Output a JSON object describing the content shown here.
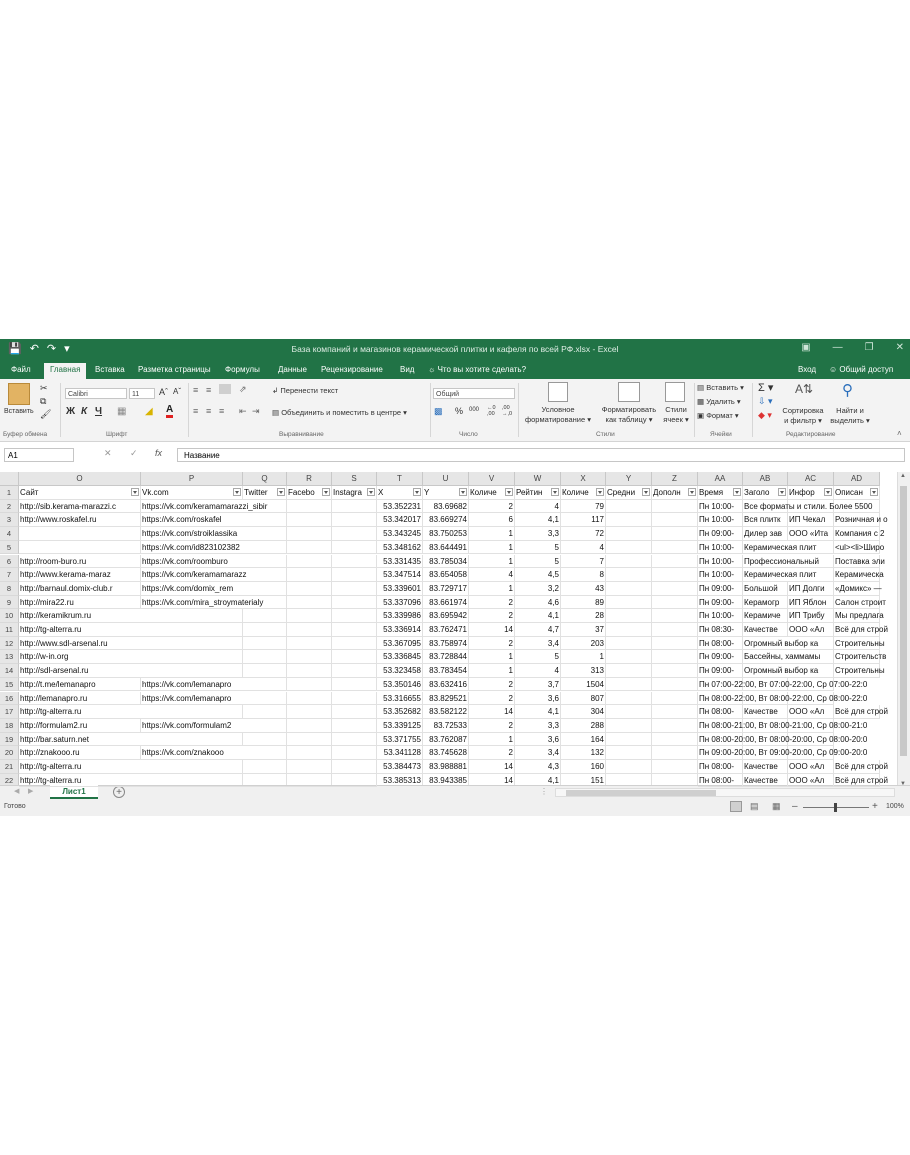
{
  "window": {
    "title": "База компаний и магазинов керамической плитки и кафеля по всей РФ.xlsx - Excel"
  },
  "menu": {
    "tabs": [
      "Файл",
      "Главная",
      "Вставка",
      "Разметка страницы",
      "Формулы",
      "Данные",
      "Рецензирование",
      "Вид"
    ],
    "tell_me": "Что вы хотите сделать?",
    "signin": "Вход",
    "share": "Общий доступ"
  },
  "ribbon": {
    "clipboard": {
      "paste": "Вставить",
      "label": "Буфер обмена"
    },
    "font": {
      "name": "Calibri",
      "size": "11",
      "bold": "Ж",
      "italic": "К",
      "underline": "Ч",
      "label": "Шрифт"
    },
    "alignment": {
      "wrap": "Перенести текст",
      "merge": "Объединить и поместить в центре",
      "label": "Выравнивание"
    },
    "number": {
      "format": "Общий",
      "label": "Число"
    },
    "styles": {
      "conditional_1": "Условное",
      "conditional_2": "форматирование",
      "as_table_1": "Форматировать",
      "as_table_2": "как таблицу",
      "cell_styles_1": "Стили",
      "cell_styles_2": "ячеек",
      "label": "Стили"
    },
    "cells": {
      "insert": "Вставить",
      "delete": "Удалить",
      "format": "Формат",
      "label": "Ячейки"
    },
    "editing": {
      "sort_1": "Сортировка",
      "sort_2": "и фильтр",
      "find_1": "Найти и",
      "find_2": "выделить",
      "label": "Редактирование"
    }
  },
  "formula_bar": {
    "name_box": "A1",
    "fx": "fx",
    "formula": "Название"
  },
  "columns": [
    {
      "letter": "O",
      "header": "Сайт"
    },
    {
      "letter": "P",
      "header": "Vk.com"
    },
    {
      "letter": "Q",
      "header": "Twitter"
    },
    {
      "letter": "R",
      "header": "Facebo"
    },
    {
      "letter": "S",
      "header": "Instagra"
    },
    {
      "letter": "T",
      "header": "X"
    },
    {
      "letter": "U",
      "header": "Y"
    },
    {
      "letter": "V",
      "header": "Количе"
    },
    {
      "letter": "W",
      "header": "Рейтин"
    },
    {
      "letter": "X",
      "header": "Количе"
    },
    {
      "letter": "Y",
      "header": "Средни"
    },
    {
      "letter": "Z",
      "header": "Дополн"
    },
    {
      "letter": "AA",
      "header": "Время"
    },
    {
      "letter": "AB",
      "header": "Заголо"
    },
    {
      "letter": "AC",
      "header": "Инфор"
    },
    {
      "letter": "AD",
      "header": "Описан"
    }
  ],
  "row_numbers": [
    "1",
    "2",
    "3",
    "4",
    "5",
    "6",
    "7",
    "8",
    "9",
    "10",
    "11",
    "12",
    "13",
    "14",
    "15",
    "16",
    "17",
    "18",
    "19",
    "20",
    "21",
    "22"
  ],
  "rows": [
    [
      "http://sib.kerama-marazzi.c",
      "https://vk.com/keramamarazzi_sibir",
      "",
      "",
      "",
      "53.352231",
      "83.69682",
      "2",
      "4",
      "79",
      "",
      "",
      "Пн 10:00-",
      "Все форматы и стили. Более 5500",
      "",
      ""
    ],
    [
      "http://www.roskafel.ru",
      "https://vk.com/roskafel",
      "",
      "",
      "",
      "53.342017",
      "83.669274",
      "6",
      "4,1",
      "117",
      "",
      "",
      "Пн 10:00-",
      "Вся плитк",
      "ИП Чекал",
      "Розничная и о"
    ],
    [
      "",
      "https://vk.com/stroiklassika",
      "",
      "",
      "",
      "53.343245",
      "83.750253",
      "1",
      "3,3",
      "72",
      "",
      "",
      "Пн 09:00-",
      "Дилер зав",
      "ООО «Ита",
      "Компания с 2"
    ],
    [
      "",
      "https://vk.com/id823102382",
      "",
      "",
      "",
      "53.348162",
      "83.644491",
      "1",
      "5",
      "4",
      "",
      "",
      "Пн 10:00-",
      "Керамическая плит",
      "",
      "<ul><li>Широ"
    ],
    [
      "http://room-buro.ru",
      "https://vk.com/roomburo",
      "",
      "",
      "",
      "53.331435",
      "83.785034",
      "1",
      "5",
      "7",
      "",
      "",
      "Пн 10:00-",
      "Профессиональный",
      "",
      "Поставка эли"
    ],
    [
      "http://www.kerama-maraz",
      "https://vk.com/keramamarazz",
      "",
      "",
      "",
      "53.347514",
      "83.654058",
      "4",
      "4,5",
      "8",
      "",
      "",
      "Пн 10:00-",
      "Керамическая плит",
      "",
      "Керамическа"
    ],
    [
      "http://barnaul.domix-club.r",
      "https://vk.com/domix_rem",
      "",
      "",
      "",
      "53.339601",
      "83.729717",
      "1",
      "3,2",
      "43",
      "",
      "",
      "Пн 09:00-",
      "Большой",
      "ИП Долги",
      "«Домикс» —"
    ],
    [
      "http://mira22.ru",
      "https://vk.com/mira_stroymaterialy",
      "",
      "",
      "",
      "53.337096",
      "83.661974",
      "2",
      "4,6",
      "89",
      "",
      "",
      "Пн 09:00-",
      "Керамогр",
      "ИП Яблон",
      "Салон строит"
    ],
    [
      "http://keramikrum.ru",
      "",
      "",
      "",
      "",
      "53.339986",
      "83.695942",
      "2",
      "4,1",
      "28",
      "",
      "",
      "Пн 10:00-",
      "Керамиче",
      "ИП Трибу",
      "Мы предлага"
    ],
    [
      "http://tg-alterra.ru",
      "",
      "",
      "",
      "",
      "53.336914",
      "83.762471",
      "14",
      "4,7",
      "37",
      "",
      "",
      "Пн 08:30-",
      "Качестве",
      "ООО «Ал",
      "Всё для строй"
    ],
    [
      "http://www.sdl-arsenal.ru",
      "",
      "",
      "",
      "",
      "53.367095",
      "83.758974",
      "2",
      "3,4",
      "203",
      "",
      "",
      "Пн 08:00-",
      "Огромный выбор ка",
      "",
      "Строительны"
    ],
    [
      "http://w-in.org",
      "",
      "",
      "",
      "",
      "53.336845",
      "83.728844",
      "1",
      "5",
      "1",
      "",
      "",
      "Пн 09:00-",
      "Бассейны, хаммамы",
      "",
      "Строительств"
    ],
    [
      "http://sdl-arsenal.ru",
      "",
      "",
      "",
      "",
      "53.323458",
      "83.783454",
      "1",
      "4",
      "313",
      "",
      "",
      "Пн 09:00-",
      "Огромный выбор ка",
      "",
      "Строительны"
    ],
    [
      "http://t.me/lemanapro",
      "https://vk.com/lemanapro",
      "",
      "",
      "",
      "53.350146",
      "83.632416",
      "2",
      "3,7",
      "1504",
      "",
      "",
      "Пн 07:00-22:00, Вт 07:00-22:00, Ср 07:00-22:0",
      "",
      ""
    ],
    [
      "http://lemanapro.ru",
      "https://vk.com/lemanapro",
      "",
      "",
      "",
      "53.316655",
      "83.829521",
      "2",
      "3,6",
      "807",
      "",
      "",
      "Пн 08:00-22:00, Вт 08:00-22:00, Ср 08:00-22:0",
      "",
      ""
    ],
    [
      "http://tg-alterra.ru",
      "",
      "",
      "",
      "",
      "53.352682",
      "83.582122",
      "14",
      "4,1",
      "304",
      "",
      "",
      "Пн 08:00-",
      "Качестве",
      "ООО «Ал",
      "Всё для строй"
    ],
    [
      "http://formulam2.ru",
      "https://vk.com/formulam2",
      "",
      "",
      "",
      "53.339125",
      "83.72533",
      "2",
      "3,3",
      "288",
      "",
      "",
      "Пн 08:00-21:00, Вт 08:00-21:00, Ср 08:00-21:0",
      "",
      ""
    ],
    [
      "http://bar.saturn.net",
      "",
      "",
      "",
      "",
      "53.371755",
      "83.762087",
      "1",
      "3,6",
      "164",
      "",
      "",
      "Пн 08:00-20:00, Вт 08:00-20:00, Ср 08:00-20:0",
      "",
      ""
    ],
    [
      "http://znakooo.ru",
      "https://vk.com/znakooo",
      "",
      "",
      "",
      "53.341128",
      "83.745628",
      "2",
      "3,4",
      "132",
      "",
      "",
      "Пн 09:00-20:00, Вт 09:00-20:00, Ср 09:00-20:0",
      "",
      ""
    ],
    [
      "http://tg-alterra.ru",
      "",
      "",
      "",
      "",
      "53.384473",
      "83.988881",
      "14",
      "4,3",
      "160",
      "",
      "",
      "Пн 08:00-",
      "Качестве",
      "ООО «Ал",
      "Всё для строй"
    ],
    [
      "http://tg-alterra.ru",
      "",
      "",
      "",
      "",
      "53.385313",
      "83.943385",
      "14",
      "4,1",
      "151",
      "",
      "",
      "Пн 08:00-",
      "Качестве",
      "ООО «Ал",
      "Всё для строй"
    ]
  ],
  "sheet": {
    "tab": "Лист1"
  },
  "status": {
    "ready": "Готово",
    "zoom": "100%"
  }
}
